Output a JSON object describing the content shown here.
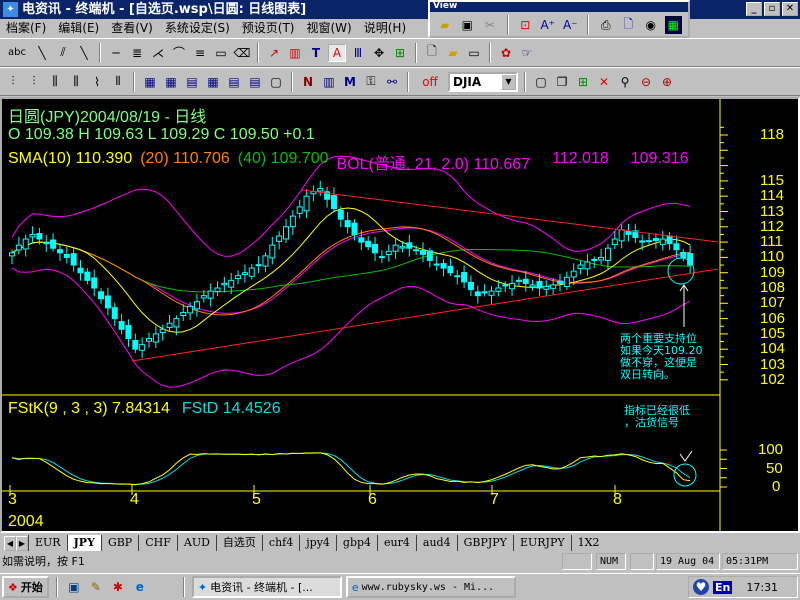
{
  "window": {
    "title": "电资讯 - 终端机 - [自选页.wsp\\日圆: 日线图表]",
    "min": "_",
    "restore": "▫",
    "close": "✕"
  },
  "menu": [
    "档案(F)",
    "编辑(E)",
    "查看(V)",
    "系统设定(S)",
    "预设页(T)",
    "视窗(W)",
    "说明(H)"
  ],
  "float_toolbar": {
    "title": "View"
  },
  "toolbar": {
    "off_label": "off",
    "symbol": "DJIA"
  },
  "chart": {
    "title": "日圆(JPY)2004/08/19  - 日线",
    "ohlc": "O 109.38 H 109.63 L 109.29 C 109.50  +0.1",
    "sma10": "SMA(10) 110.390",
    "sma20": "(20) 110.706",
    "sma40": "(40) 109.700",
    "bol": "BOL(普通, 21, 2.0)  110.667",
    "bol_up": "112.018",
    "bol_lo": "109.316",
    "fstk": "FStK(9 , 3 , 3)  7.84314",
    "fstd": "FStD  14.4526",
    "annotation1": [
      "两个重要支持位",
      "如果今天109.20",
      "做不穿，这便是",
      "双日转向。"
    ],
    "annotation2": [
      "指标已经很低",
      "，沽货信号"
    ],
    "year": "2004",
    "months": [
      "3",
      "4",
      "5",
      "6",
      "7",
      "8"
    ],
    "price_ticks": [
      "118",
      "115",
      "114",
      "113",
      "112",
      "111",
      "110",
      "109",
      "108",
      "107",
      "106",
      "105",
      "104",
      "103",
      "102"
    ],
    "stoch_ticks": [
      "100",
      "50",
      "0"
    ],
    "colors": {
      "sma10": "#ffff00",
      "sma20": "#ff8000",
      "sma40": "#00c000",
      "bol": "#ff00ff",
      "trend": "#ff2020",
      "stk": "#ffff00",
      "std": "#00e0e0",
      "annot": "#00ffff"
    }
  },
  "chart_data": {
    "type": "candlestick",
    "title": "日圆(JPY) 日线",
    "x_range": [
      "2004-03",
      "2004-08-19"
    ],
    "ylim": [
      102,
      118
    ],
    "closes": [
      110.3,
      110.8,
      111.2,
      111.5,
      111.2,
      110.9,
      110.6,
      110.3,
      110.0,
      109.5,
      109.0,
      108.5,
      108.0,
      107.3,
      106.7,
      106.0,
      105.3,
      104.7,
      104.0,
      104.3,
      104.7,
      105.0,
      105.3,
      105.7,
      106.0,
      106.4,
      106.8,
      107.1,
      107.5,
      107.8,
      108.0,
      108.3,
      108.5,
      108.8,
      109.0,
      109.3,
      109.5,
      110.1,
      110.8,
      111.4,
      112.0,
      112.7,
      113.3,
      114.0,
      114.3,
      114.5,
      113.8,
      113.2,
      112.5,
      112.0,
      111.5,
      111.0,
      110.7,
      110.3,
      110.0,
      110.4,
      110.8,
      110.7,
      110.6,
      110.5,
      110.2,
      109.8,
      109.5,
      109.3,
      109.0,
      108.8,
      108.4,
      107.9,
      107.5,
      107.7,
      107.8,
      108.0,
      108.2,
      108.3,
      108.5,
      108.3,
      108.2,
      108.0,
      108.1,
      108.2,
      108.3,
      108.7,
      109.1,
      109.5,
      109.7,
      109.8,
      110.0,
      110.6,
      111.2,
      111.8,
      111.5,
      111.3,
      111.0,
      111.1,
      111.1,
      111.2,
      110.9,
      110.5,
      110.0,
      109.5
    ]
  },
  "tabs": [
    "EUR",
    "JPY",
    "GBP",
    "CHF",
    "AUD",
    "自选页",
    "chf4",
    "jpy4",
    "gbp4",
    "eur4",
    "aud4",
    "GBPJPY",
    "EURJPY",
    "1X2"
  ],
  "status": {
    "help": "如需说明，按 F1",
    "num": "NUM",
    "date": "19 Aug 04",
    "time": "05:31PM"
  },
  "taskbar": {
    "start": "开始",
    "task1": "电资讯 - 终端机 - [...",
    "task2": "www.rubysky.ws - Mi...",
    "lang": "En",
    "clock": "17:31"
  }
}
